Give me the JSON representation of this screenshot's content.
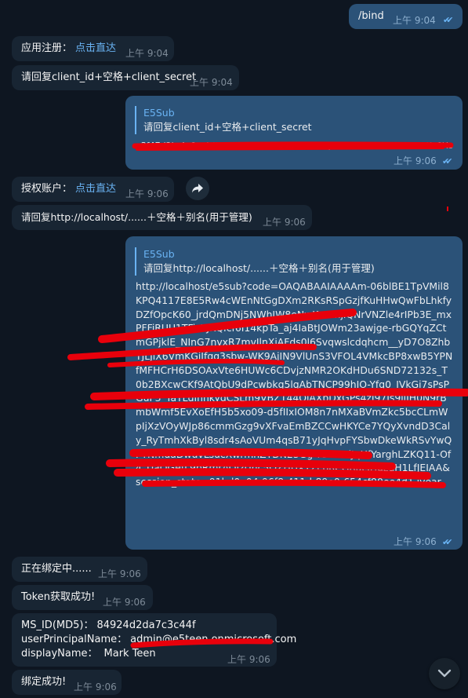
{
  "messages": {
    "bind_cmd": {
      "text": "/bind",
      "time": "上午 9:04"
    },
    "app_register": {
      "label": "应用注册：",
      "link": "点击直达",
      "time": "上午 9:04"
    },
    "reply_client": {
      "text": "请回复client_id+空格+client_secret",
      "time": "上午 9:04"
    },
    "quoted_client": {
      "quote_name": "E5Sub",
      "quote_text": "请回复client_id+空格+client_secret",
      "body": "a3f47d2b-4e8c-4d17-9b61-2c5a8e0f93d1 Xq8~Lm2Tz7Vb.Pw4Rn0Kc6Hs9Jd_Fg3Ya1Ue5Io",
      "time": "上午 9:06"
    },
    "auth_account": {
      "label": "授权账户：",
      "link": "点击直达",
      "time": "上午 9:06"
    },
    "reply_localhost": {
      "text": "请回复http://localhost/......＋空格＋别名(用于管理)",
      "time": "上午 9:06"
    },
    "quoted_localhost": {
      "quote_name": "E5Sub",
      "quote_text": "请回复http://localhost/......＋空格＋别名(用于管理)",
      "body": "http://localhost/e5sub?code=OAQABAAIAAAAm-06blBE1TpVMil8KPQ4117E8E5Rw4cWEnNtGgDXm2RKsRSpGzjfKuHHwQwFbLhkfyDZfOpcK60_jrdQmDNj5NWhJW8eNwKwwnjlQNrVNZle4rIPb3E_mxPFFiRUU1TFiz7JKQIcf6I14kpTa_aj4IaBtJOWm23awjge-rbGQYqZCtmGPjklE_NInG7nvxR7mvJlnXjAFds0l6Svqwslcdqhcm__yD7O8ZhbYJLJiX6VmKGiIfgg3sbw-WK9AjIN9VlUnS3VFOL4VMkcBP8xwB5YPNfMFHCrH6DSOAxVte6HUWc6CDvjzNMR2OKdHDu6SND72132s_T0b2BXcwCKf9AtQbU9dPcwbkq5lqAbTNCP99hIO-Yfq0_IVkGi7sPsPGuF3_YaTLdInnkygCSLm9VBZ144QjAXbDxGPs4zI97Js9jjIH0N9rBmbWmf5EvXoEfH5b5xo09-d5fIIxIOM8n7nMXaBVmZkc5bcCLmWpIjXzVOyWJp86cmmGzg9vXFvaEmBZCCwHKYCe7YQyXvndD3Caly_RyTmhXkByl8sdr4sAoVUm4qsB71yJqHvpFYSbwDkeWkRSvYwQPTNmdaDwuvLsucXwrmnZTDN23Gg-TSrHtxiJqHfYarghLZKQ11-Of4_UaQGefL9bRmrAQIzUhc5QZHUXYZcpRCGRucJHdzqH1LfJEIAA&session_state=91bd0a04-96f8-411d-89e0-654cf90ee4d1 iyear",
      "time": "上午 9:06"
    },
    "binding": {
      "text": "正在绑定中......",
      "time": "上午 9:06"
    },
    "token_ok": {
      "text": "Token获取成功!",
      "time": "上午 9:06"
    },
    "profile": {
      "ms_id_label": "MS_ID(MD5)：",
      "ms_id_value": "84924d2da7c3c44f",
      "upn_label": "userPrincipalName：",
      "upn_value": "admin@e5teen.onmicrosoft.com",
      "display_label": "displayName：",
      "display_value": "Mark Teen",
      "time": "上午 9:06"
    },
    "bind_ok": {
      "text": "绑定成功!",
      "time": "上午 9:06"
    }
  },
  "icons": {
    "read_check": "✔✔",
    "forward": "forward-arrow",
    "scroll_down": "chevron-down"
  },
  "colors": {
    "background": "#0e1621",
    "incoming_bubble": "#182533",
    "outgoing_bubble": "#2b5278",
    "accent": "#6ab3f3",
    "redaction": "#e8000b"
  }
}
